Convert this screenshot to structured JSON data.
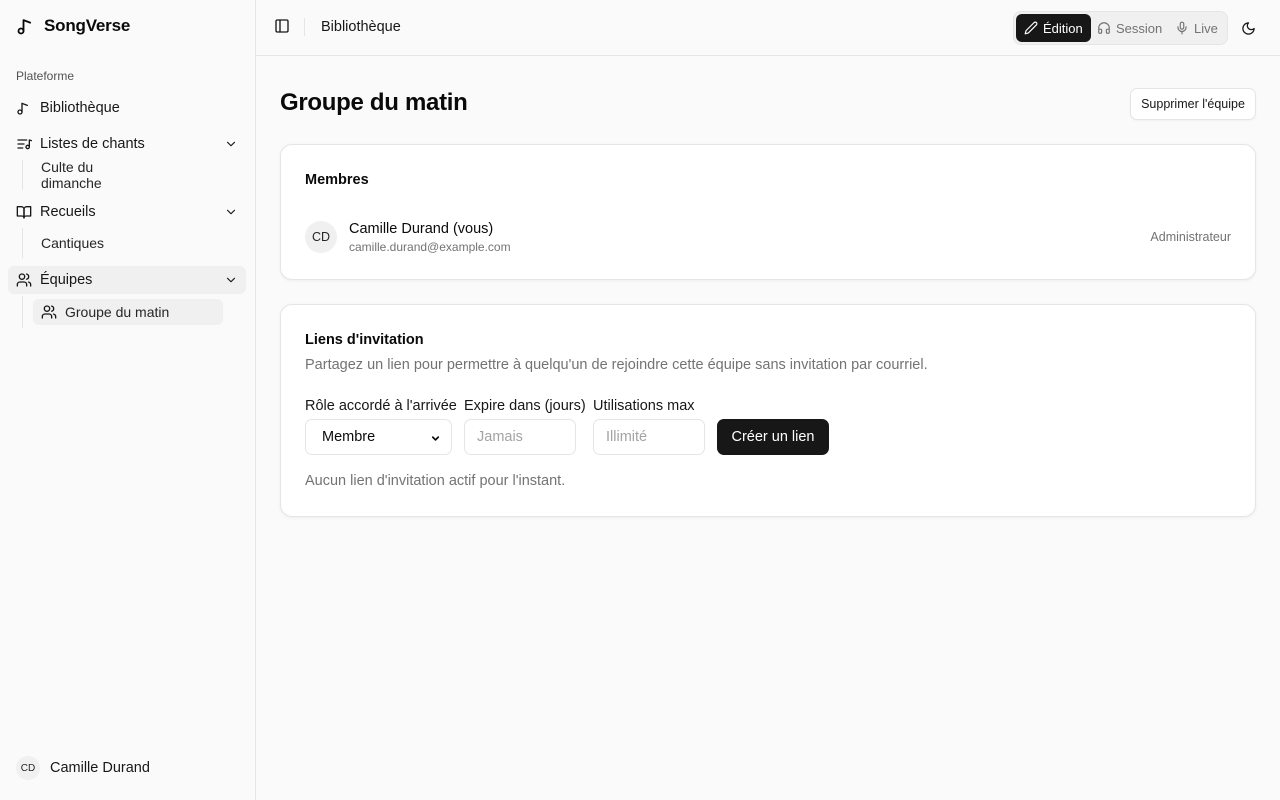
{
  "app": {
    "name": "SongVerse",
    "logo_icon": "music-note-icon"
  },
  "sidebar": {
    "section_label": "Plateforme",
    "items": [
      {
        "label": "Bibliothèque",
        "icon": "music-note-icon"
      },
      {
        "label": "Listes de chants",
        "icon": "list-music-icon",
        "sub": [
          "Culte du dimanche"
        ]
      },
      {
        "label": "Recueils",
        "icon": "book-open-icon",
        "sub": [
          "Cantiques"
        ]
      },
      {
        "label": "Équipes",
        "icon": "users-icon",
        "sub": [
          "Groupe du matin"
        ]
      }
    ],
    "user": {
      "initials": "CD",
      "name": "Camille Durand"
    }
  },
  "topbar": {
    "breadcrumb": "Bibliothèque",
    "modes": [
      {
        "label": "Édition",
        "icon": "pencil-icon",
        "active": true
      },
      {
        "label": "Session",
        "icon": "headphones-icon",
        "active": false
      },
      {
        "label": "Live",
        "icon": "microphone-icon",
        "active": false
      }
    ]
  },
  "page": {
    "title": "Groupe du matin",
    "delete_label": "Supprimer l'équipe"
  },
  "members": {
    "title": "Membres",
    "list": [
      {
        "initials": "CD",
        "name": "Camille Durand (vous)",
        "email": "camille.durand@example.com",
        "role": "Administrateur"
      }
    ]
  },
  "invites": {
    "title": "Liens d'invitation",
    "description": "Partagez un lien pour permettre à quelqu'un de rejoindre cette équipe sans invitation par courriel.",
    "role_label": "Rôle accordé à l'arrivée",
    "role_value": "Membre",
    "expire_label": "Expire dans (jours)",
    "expire_placeholder": "Jamais",
    "max_label": "Utilisations max",
    "max_placeholder": "Illimité",
    "create_label": "Créer un lien",
    "empty_text": "Aucun lien d'invitation actif pour l'instant."
  },
  "colors": {
    "primary": "#171717",
    "muted": "#737373",
    "border": "#e5e5e5",
    "background": "#fafafa"
  }
}
